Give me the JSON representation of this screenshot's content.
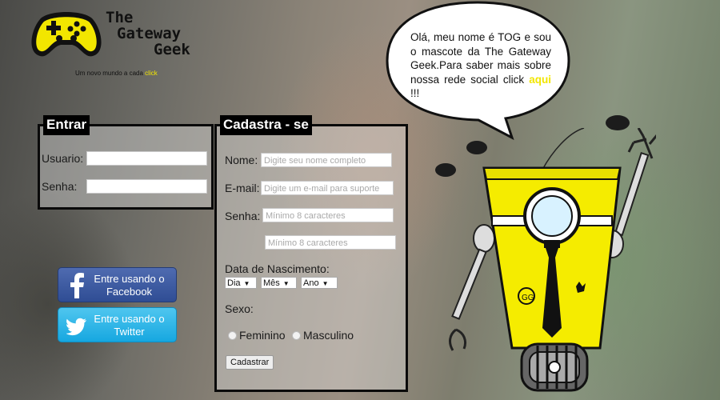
{
  "brand": {
    "name_lines": [
      "The",
      "Gateway",
      "Geek"
    ],
    "tagline": "Um novo mundo a cada",
    "tagline_accent": "click",
    "logo_icon": "gamepad-icon"
  },
  "login": {
    "title": "Entrar",
    "user_label": "Usuario:",
    "user_value": "",
    "password_label": "Senha:",
    "password_value": ""
  },
  "signup": {
    "title": "Cadastra - se",
    "name_label": "Nome:",
    "name_placeholder": "Digite seu nome completo",
    "email_label": "E-mail:",
    "email_placeholder": "Digite um e-mail para suporte",
    "password_label": "Senha:",
    "password_placeholder": "Mínimo 8 caracteres",
    "password_confirm_placeholder": "Mínimo 8 caracteres",
    "birth_label": "Data de Nascimento:",
    "day": "Dia",
    "month": "Mês",
    "year": "Ano",
    "sex_label": "Sexo:",
    "female": "Feminino",
    "male": "Masculino",
    "submit": "Cadastrar"
  },
  "social": {
    "facebook_label": "Entre usando o Facebook",
    "facebook_icon": "facebook-icon",
    "facebook_color": "#3b5998",
    "twitter_label": "Entre usando o Twitter",
    "twitter_icon": "twitter-bird-icon",
    "twitter_color": "#1da1f2"
  },
  "mascot": {
    "speech": "Olá, meu nome é TOG e sou o mascote da The Gateway Geek.Para saber mais sobre nossa rede social click",
    "link": "aqui",
    "after": " !!!",
    "badge": "GG"
  },
  "colors": {
    "accent_yellow": "#f2e600",
    "panel_border": "#0a0a0a"
  }
}
